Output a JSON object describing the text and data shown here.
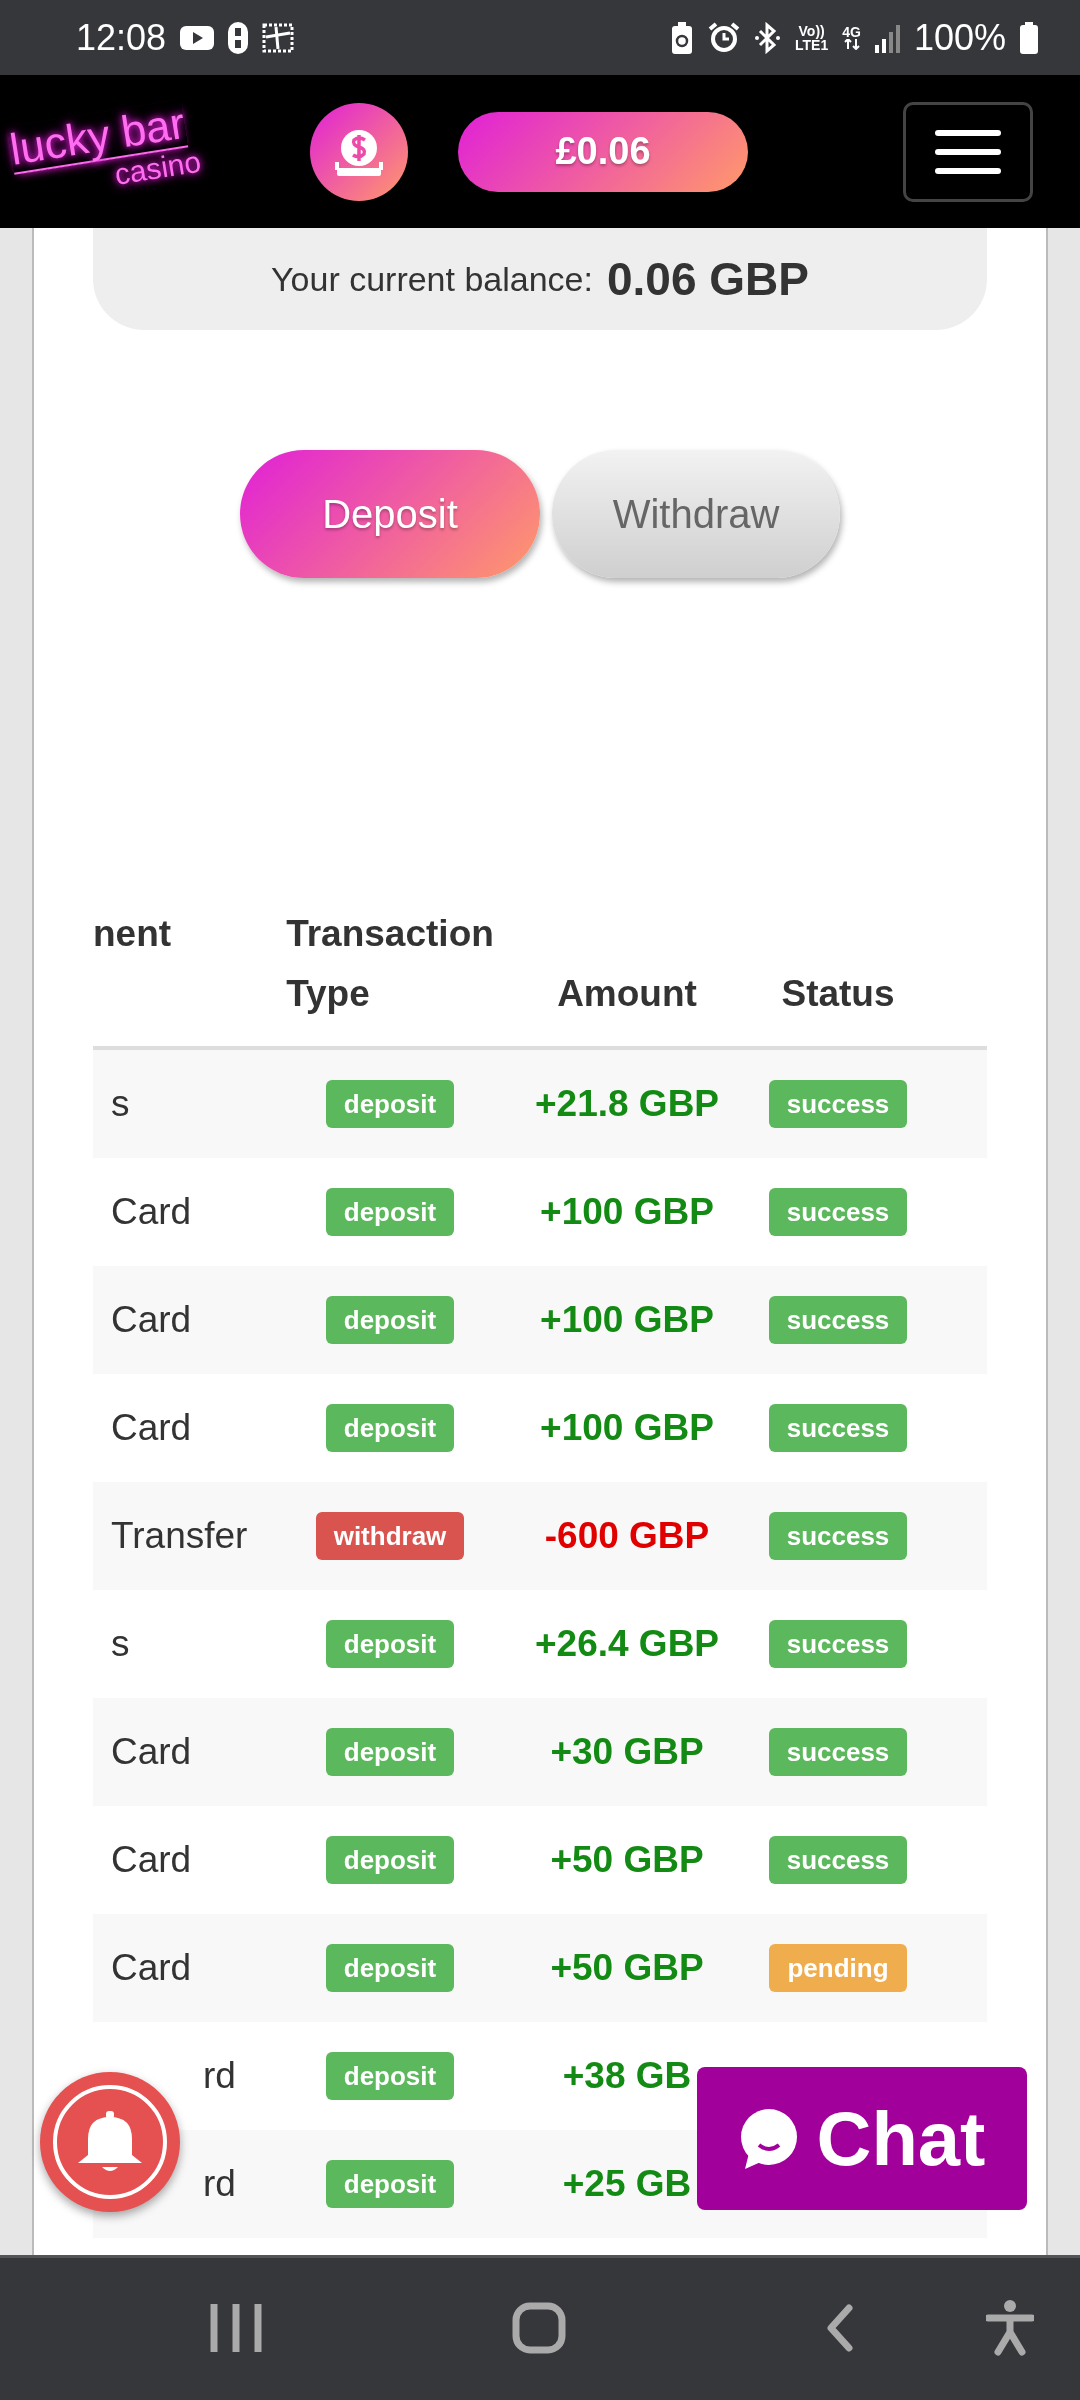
{
  "status_bar": {
    "time": "12:08",
    "network_labels": [
      "Vo))",
      "LTE1"
    ],
    "data_label": "4G",
    "battery": "100%"
  },
  "header": {
    "logo": {
      "line1": "lucky bar",
      "line2": "casino"
    },
    "balance_button": "£0.06"
  },
  "balance_card": {
    "label": "Your current balance:",
    "value": "0.06 GBP"
  },
  "tabs": [
    {
      "label": "Deposit",
      "selected": true
    },
    {
      "label": "Withdraw",
      "selected": false
    }
  ],
  "table": {
    "columns": [
      {
        "lines": [
          "nent"
        ]
      },
      {
        "lines": [
          "Transaction",
          "Type"
        ]
      },
      {
        "lines": [
          "Amount"
        ]
      },
      {
        "lines": [
          "Status"
        ]
      }
    ],
    "rows": [
      {
        "column_1": "s",
        "type": {
          "label": "deposit",
          "kind": "deposit"
        },
        "amount": "+21.8 GBP",
        "status": {
          "label": "success",
          "kind": "success"
        }
      },
      {
        "column_1": "Card",
        "type": {
          "label": "deposit",
          "kind": "deposit"
        },
        "amount": "+100 GBP",
        "status": {
          "label": "success",
          "kind": "success"
        }
      },
      {
        "column_1": "Card",
        "type": {
          "label": "deposit",
          "kind": "deposit"
        },
        "amount": "+100 GBP",
        "status": {
          "label": "success",
          "kind": "success"
        }
      },
      {
        "column_1": "Card",
        "type": {
          "label": "deposit",
          "kind": "deposit"
        },
        "amount": "+100 GBP",
        "status": {
          "label": "success",
          "kind": "success"
        }
      },
      {
        "column_1": "Transfer",
        "type": {
          "label": "withdraw",
          "kind": "withdraw"
        },
        "amount": "-600 GBP",
        "status": {
          "label": "success",
          "kind": "success"
        }
      },
      {
        "column_1": "s",
        "type": {
          "label": "deposit",
          "kind": "deposit"
        },
        "amount": "+26.4 GBP",
        "status": {
          "label": "success",
          "kind": "success"
        }
      },
      {
        "column_1": "Card",
        "type": {
          "label": "deposit",
          "kind": "deposit"
        },
        "amount": "+30 GBP",
        "status": {
          "label": "success",
          "kind": "success"
        }
      },
      {
        "column_1": "Card",
        "type": {
          "label": "deposit",
          "kind": "deposit"
        },
        "amount": "+50 GBP",
        "status": {
          "label": "success",
          "kind": "success"
        }
      },
      {
        "column_1": "Card",
        "type": {
          "label": "deposit",
          "kind": "deposit"
        },
        "amount": "+50 GBP",
        "status": {
          "label": "pending",
          "kind": "pending"
        }
      },
      {
        "column_1": "rd",
        "type": {
          "label": "deposit",
          "kind": "deposit"
        },
        "amount": "+38 GB"
      },
      {
        "column_1": "rd",
        "type": {
          "label": "deposit",
          "kind": "deposit"
        },
        "amount": "+25 GB"
      }
    ]
  },
  "chat_button": {
    "label": "Chat"
  }
}
